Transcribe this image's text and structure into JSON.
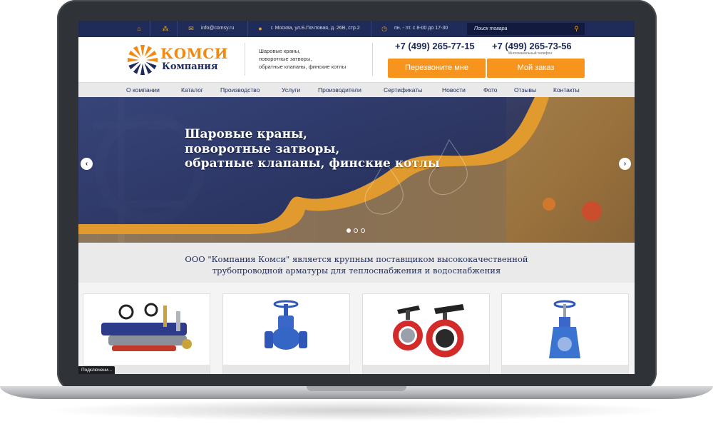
{
  "topbar": {
    "email": "info@comsy.ru",
    "address": "г. Москва, ул.Б.Почтовая, д. 26В, стр.2",
    "hours": "пн. - пт. с 8-00 до 17-30",
    "search_placeholder": "Поиск товара",
    "icons": [
      "home-icon",
      "sitemap-icon",
      "mail-icon",
      "location-pin-icon",
      "clock-icon",
      "search-icon"
    ]
  },
  "header": {
    "logo_title": "КОМСИ",
    "logo_subtitle": "Компания",
    "tagline": [
      "Шаровые краны,",
      "поворотные затворы,",
      "обратные клапаны, финские котлы"
    ],
    "phone1": "+7 (499) 265-77-15",
    "phone2": "+7 (499) 265-73-56",
    "phone2_note": "Многоканальный телефон",
    "callback_button": "Перезвоните мне",
    "order_button": "Мой заказ"
  },
  "nav": [
    "О компании",
    "Каталог",
    "Производство",
    "Услуги",
    "Производители",
    "Сертификаты",
    "Новости",
    "Фото",
    "Отзывы",
    "Контакты"
  ],
  "banner": {
    "lines": [
      "Шаровые краны,",
      "поворотные затворы,",
      "обратные клапаны, финские котлы"
    ],
    "slides": 3,
    "active_slide": 1
  },
  "intro": {
    "line1": "ООО \"Компания Комси\" является крупным поставщиком высококачественной",
    "line2": "трубопроводной арматуры для теплоснабжения и водоснабжения"
  },
  "products": [
    "valve-assortment-image",
    "globe-valve-image",
    "butterfly-valve-image",
    "knife-gate-valve-image"
  ],
  "status_text": "Подключени...",
  "colors": {
    "navy": "#1f2b58",
    "orange": "#f7941d",
    "nav_bg": "#e9e9e9"
  }
}
